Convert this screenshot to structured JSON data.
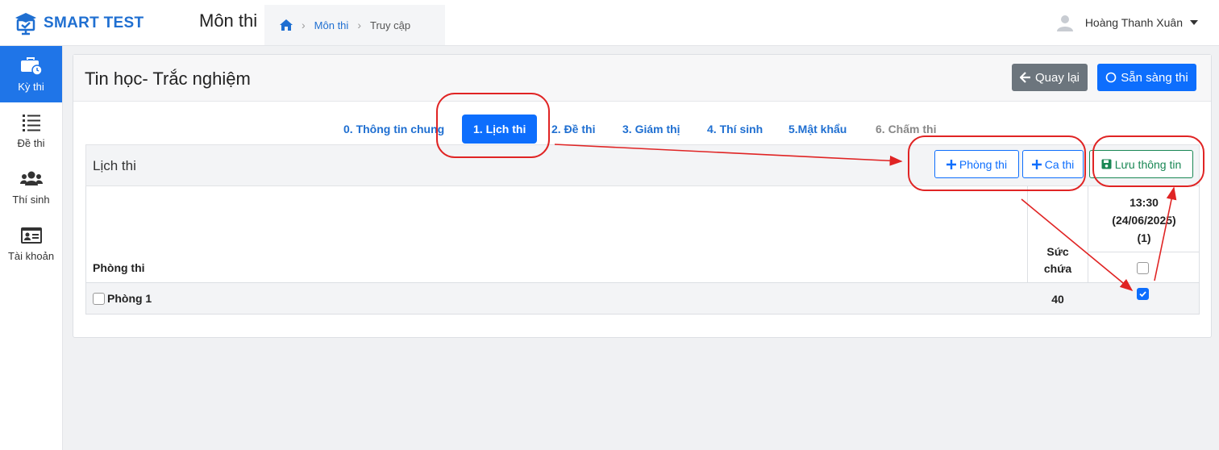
{
  "app": {
    "name": "SMART TEST"
  },
  "header": {
    "page_title": "Môn thi",
    "breadcrumb": [
      {
        "label": "Môn thi"
      },
      {
        "label": "Truy cập"
      }
    ],
    "user_name": "Hoàng Thanh Xuân"
  },
  "sidebar": {
    "items": [
      {
        "label": "Kỳ thi",
        "icon": "briefcase-clock-icon",
        "active": true
      },
      {
        "label": "Đề thi",
        "icon": "list-icon",
        "active": false
      },
      {
        "label": "Thí sinh",
        "icon": "users-icon",
        "active": false
      },
      {
        "label": "Tài khoản",
        "icon": "id-card-icon",
        "active": false
      }
    ]
  },
  "card": {
    "title": "Tin học- Trắc nghiệm",
    "back_label": "Quay lại",
    "ready_label": "Sẵn sàng thi"
  },
  "tabs": [
    {
      "label": "0. Thông tin chung"
    },
    {
      "label": "1. Lịch thi",
      "active": true
    },
    {
      "label": "2. Đề thi"
    },
    {
      "label": "3. Giám thị"
    },
    {
      "label": "4. Thí sinh"
    },
    {
      "label": "5.Mật khẩu"
    },
    {
      "label": "6. Chấm thi",
      "disabled": true
    }
  ],
  "section": {
    "title": "Lịch thi",
    "add_room_label": "Phòng thi",
    "add_shift_label": "Ca thi",
    "save_label": "Lưu thông tin"
  },
  "table": {
    "col_room": "Phòng thi",
    "col_capacity_1": "Sức",
    "col_capacity_2": "chứa",
    "shift": {
      "time": "13:30",
      "date": "(24/06/2025)",
      "count": "(1)"
    },
    "rows": [
      {
        "room": "Phòng 1",
        "capacity": "40",
        "assigned": true
      }
    ]
  },
  "colors": {
    "primary": "#0d6efd",
    "secondary": "#6c757d",
    "success": "#198754",
    "annotation": "#e02424"
  }
}
